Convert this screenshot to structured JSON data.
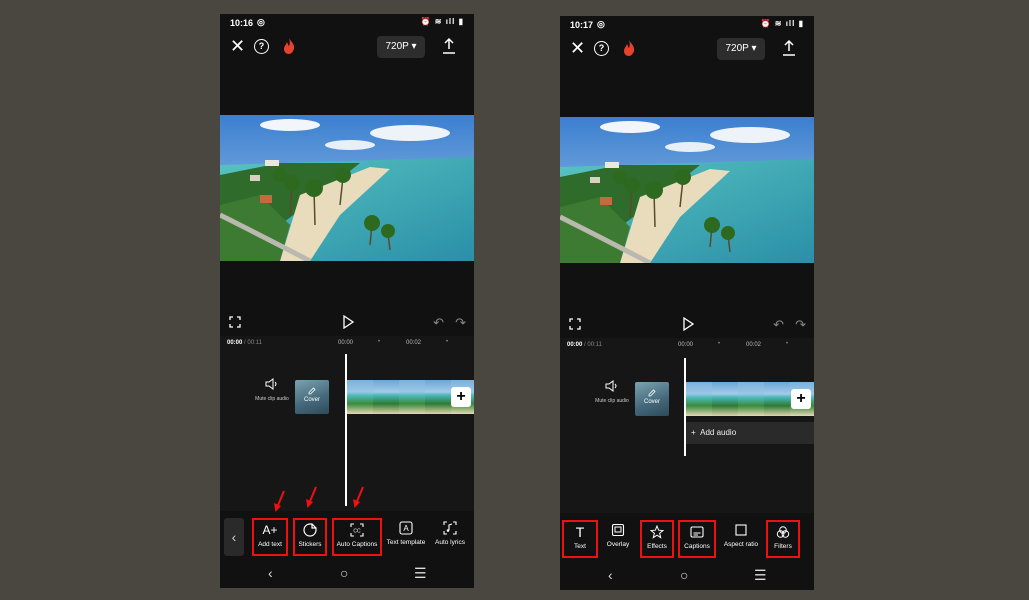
{
  "left": {
    "status": {
      "time": "10:16"
    },
    "top_bar": {
      "resolution": "720P"
    },
    "timeline": {
      "current_time": "00:00",
      "total_time": "/ 00:11",
      "tick1": "00:00",
      "tick2": "00:02",
      "mute_label": "Mute clip audio",
      "cover_label": "Cover"
    },
    "toolbar": [
      {
        "label": "Add text",
        "icon": "add-text-icon",
        "highlighted": true
      },
      {
        "label": "Stickers",
        "icon": "stickers-icon",
        "highlighted": true
      },
      {
        "label": "Auto Captions",
        "icon": "auto-captions-icon",
        "highlighted": true
      },
      {
        "label": "Text template",
        "icon": "text-template-icon",
        "highlighted": false
      },
      {
        "label": "Auto lyrics",
        "icon": "auto-lyrics-icon",
        "highlighted": false
      }
    ]
  },
  "right": {
    "status": {
      "time": "10:17"
    },
    "top_bar": {
      "resolution": "720P"
    },
    "timeline": {
      "current_time": "00:00",
      "total_time": "/ 00:11",
      "tick1": "00:00",
      "tick2": "00:02",
      "mute_label": "Mute clip audio",
      "cover_label": "Cover",
      "add_audio": "Add audio"
    },
    "toolbar": [
      {
        "label": "Text",
        "icon": "text-icon",
        "highlighted": true
      },
      {
        "label": "Overlay",
        "icon": "overlay-icon",
        "highlighted": false
      },
      {
        "label": "Effects",
        "icon": "effects-icon",
        "highlighted": true
      },
      {
        "label": "Captions",
        "icon": "captions-icon",
        "highlighted": true
      },
      {
        "label": "Aspect ratio",
        "icon": "aspect-ratio-icon",
        "highlighted": false
      },
      {
        "label": "Filters",
        "icon": "filters-icon",
        "highlighted": true
      }
    ]
  },
  "colors": {
    "highlight": "#e11111",
    "background": "#4a4640",
    "app_bg": "#111111"
  }
}
